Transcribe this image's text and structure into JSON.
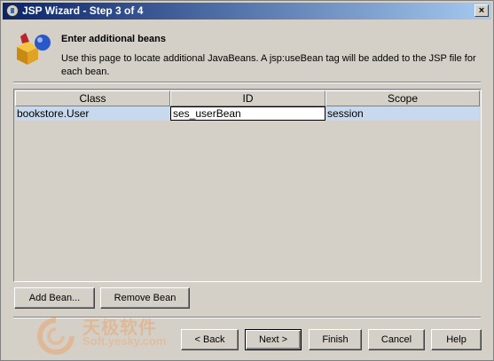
{
  "window": {
    "title": "JSP Wizard - Step 3 of 4",
    "close_glyph": "×"
  },
  "header": {
    "title": "Enter additional beans",
    "description": "Use this page to locate additional JavaBeans. A jsp:useBean tag will be added to the JSP file for each bean.",
    "icon": "beans-wizard-icon"
  },
  "table": {
    "columns": [
      "Class",
      "ID",
      "Scope"
    ],
    "rows": [
      {
        "class": "bookstore.User",
        "id": "ses_userBean",
        "scope": "session"
      }
    ]
  },
  "buttons": {
    "add_bean": "Add Bean...",
    "remove_bean": "Remove Bean",
    "back": "< Back",
    "next": "Next >",
    "finish": "Finish",
    "cancel": "Cancel",
    "help": "Help"
  },
  "watermark": {
    "text": "天极软件",
    "url": "Soft.yesky.com"
  },
  "colors": {
    "title_start": "#0a246a",
    "title_end": "#a6caf0",
    "selected_row": "#c8d9ee",
    "face": "#d4d0c8"
  }
}
